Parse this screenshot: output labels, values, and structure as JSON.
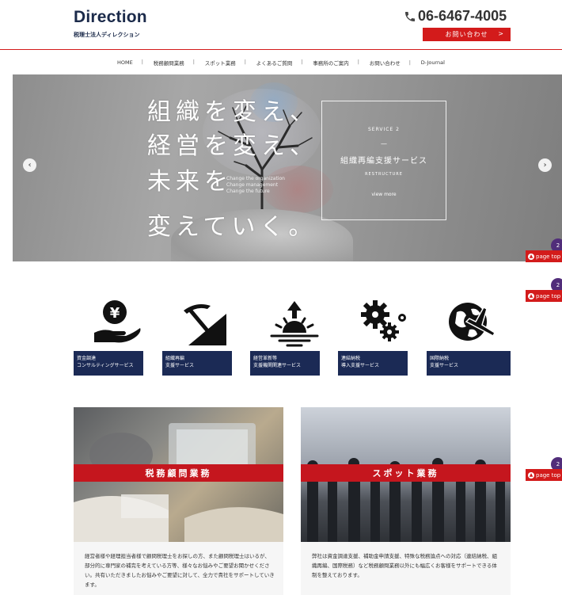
{
  "header": {
    "logo_main": "Direction",
    "logo_sub": "税理士法人ディレクション",
    "phone": "06-6467-4005",
    "contact_label": "お問い合わせ",
    "contact_chevron": ">"
  },
  "nav": {
    "items": [
      "HOME",
      "税務顧問業務",
      "スポット業務",
      "よくあるご質問",
      "事務所のご案内",
      "お問い合わせ",
      "D-Journal"
    ]
  },
  "hero": {
    "lines": [
      "組織を変え、",
      "経営を変え、",
      "未来を",
      "変えていく。"
    ],
    "en_lines": [
      "Change the organization",
      "Change management",
      "Change the future"
    ],
    "service": {
      "number": "SERVICE 2",
      "dash": "—",
      "title": "組織再編支援サービス",
      "en": "RESTRUCTURE",
      "more": "view more"
    },
    "prev": "‹",
    "next": "›"
  },
  "page_top": {
    "label": "page top",
    "badge": "2"
  },
  "services": [
    {
      "line1": "資金調達",
      "line2": "コンサルティングサービス"
    },
    {
      "line1": "組織再編",
      "line2": "支援サービス"
    },
    {
      "line1": "経営革新等",
      "line2": "支援機関関連サービス"
    },
    {
      "line1": "連結納税",
      "line2": "導入支援サービス"
    },
    {
      "line1": "国際納税",
      "line2": "支援サービス"
    }
  ],
  "cards": [
    {
      "title": "税務顧問業務",
      "text": "経営者様や経理担当者様で顧問税理士をお探しの方、また顧問税理士はいるが、部分的に専門家の補完を考えている方等、様々なお悩みやご要望お聞かせください。共有いただきましたお悩みやご要望に対して、全力で貴社をサポートしていきます。"
    },
    {
      "title": "スポット業務",
      "text": "弊社は資金調達支援、補助金申請支援、特殊な税務論点への対応（連結納税、組織再編、国際税務）など税務顧問業務以外にも幅広くお客様をサポートできる体制を整えております。"
    }
  ]
}
